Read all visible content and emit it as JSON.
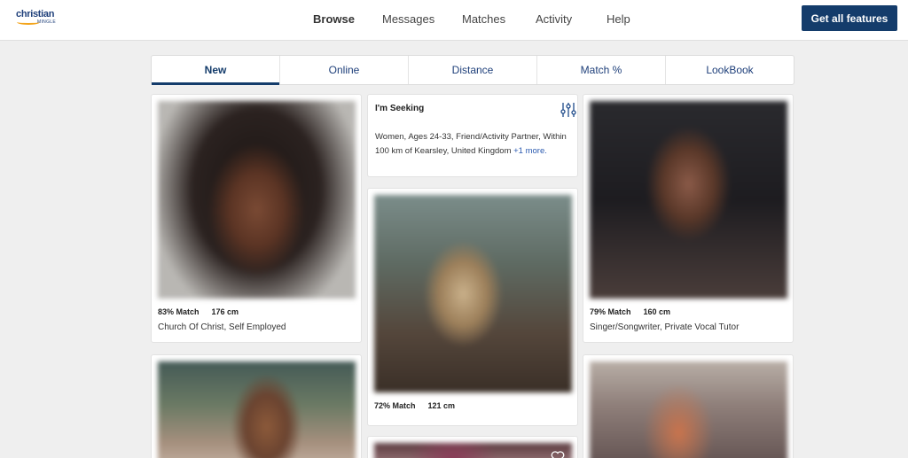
{
  "logo": {
    "line1": "christian",
    "line2": "MINGLE"
  },
  "nav": [
    {
      "label": "Browse",
      "active": true
    },
    {
      "label": "Messages"
    },
    {
      "label": "Matches"
    },
    {
      "label": "Activity"
    },
    {
      "label": "Help"
    }
  ],
  "cta_label": "Get all features",
  "tabs": [
    {
      "label": "New",
      "active": true
    },
    {
      "label": "Online"
    },
    {
      "label": "Distance"
    },
    {
      "label": "Match %"
    },
    {
      "label": "LookBook"
    }
  ],
  "seeking": {
    "title": "I'm Seeking",
    "text": "Women, Ages 24-33, Friend/Activity Partner, Within 100 km of Kearsley, United Kingdom",
    "more": "+1 more."
  },
  "profiles": [
    {
      "match": "83% Match",
      "height": "176 cm",
      "desc": "Church Of Christ, Self Employed"
    },
    {
      "match": "72% Match",
      "height": "121 cm",
      "desc": ""
    },
    {
      "match": "79% Match",
      "height": "160 cm",
      "desc": "Singer/Songwriter, Private Vocal Tutor"
    }
  ],
  "colors": {
    "brand": "#143c6b",
    "accent": "#f3a51d",
    "link": "#2b5ab0"
  }
}
